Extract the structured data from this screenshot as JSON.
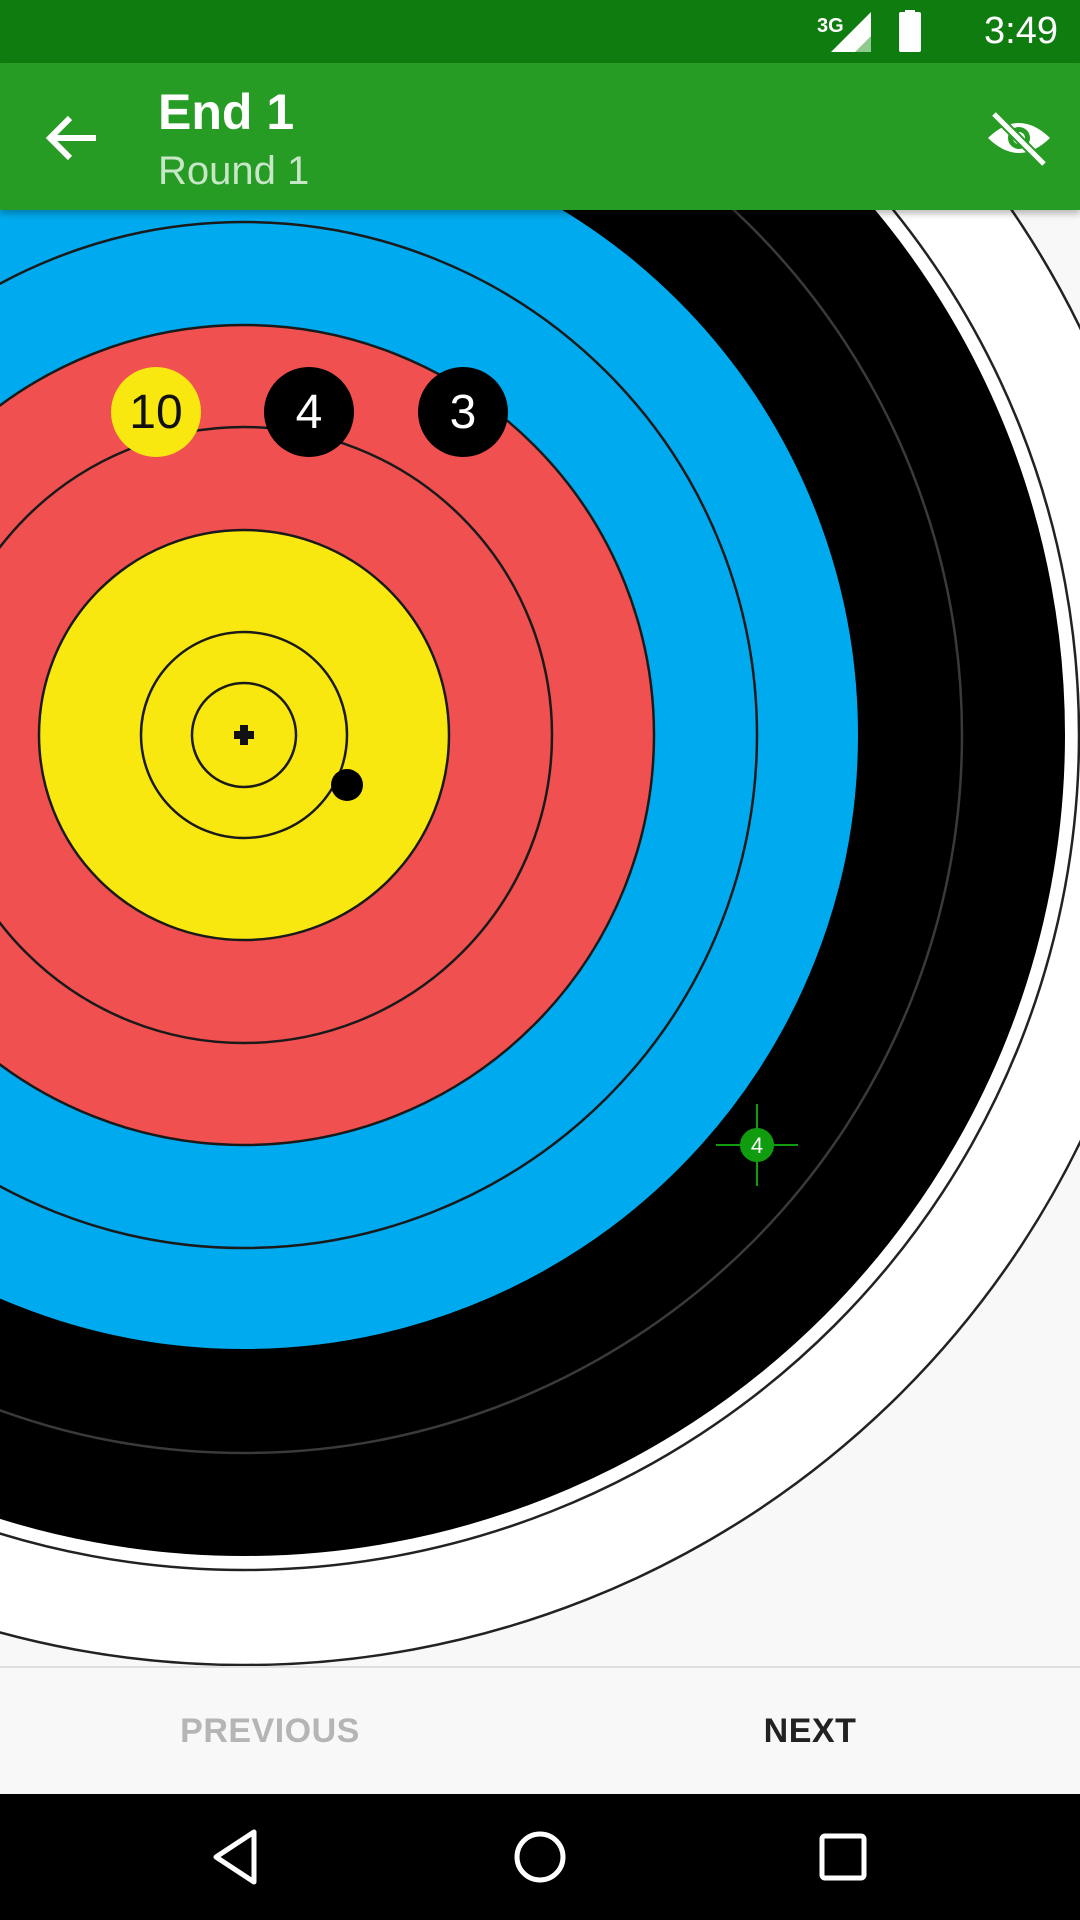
{
  "status_bar": {
    "time": "3:49",
    "network": "3G",
    "icons": [
      "signal-icon",
      "battery-icon"
    ]
  },
  "app_bar": {
    "title": "End 1",
    "subtitle": "Round 1",
    "icons": [
      "back-arrow-icon",
      "visibility-off-icon"
    ]
  },
  "target": {
    "ring_colors": {
      "white": "#ffffff",
      "black": "#000000",
      "blue": "#00aaee",
      "red": "#f05050",
      "yellow": "#f8e810"
    },
    "arrow_scores": [
      "10",
      "4",
      "3"
    ],
    "arrow_score_colors": [
      "#f8e810",
      "#000000",
      "#000000"
    ],
    "cursor_label": "4",
    "cursor_color": "#0f9d0f"
  },
  "bottom_bar": {
    "previous_label": "PREVIOUS",
    "next_label": "NEXT"
  },
  "nav_bar": {
    "icons": [
      "back-triangle-icon",
      "home-circle-icon",
      "recents-square-icon"
    ]
  }
}
